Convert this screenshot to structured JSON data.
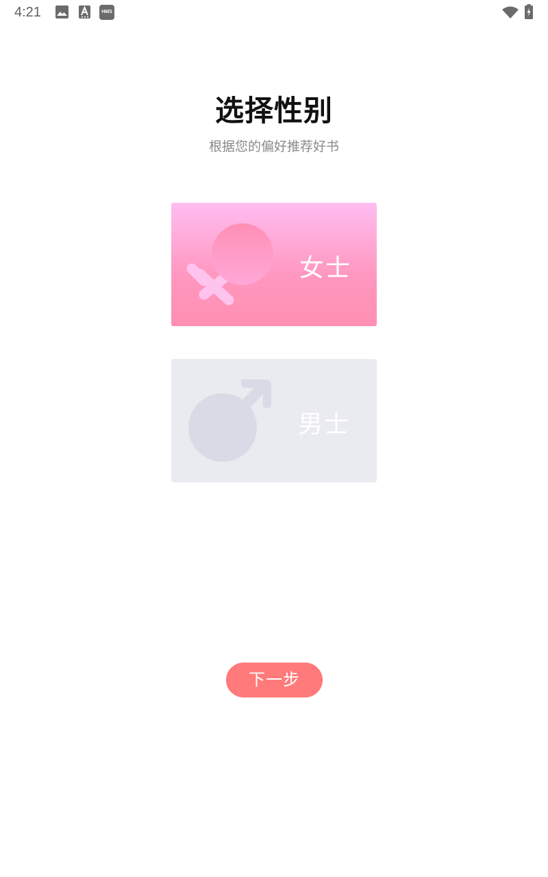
{
  "status_bar": {
    "time": "4:21",
    "hms_badge": "HMS",
    "icons": [
      "image-icon",
      "text-a-icon",
      "hms-icon",
      "wifi-icon",
      "battery-charging-icon"
    ]
  },
  "header": {
    "title": "选择性别",
    "subtitle": "根据您的偏好推荐好书"
  },
  "options": {
    "female": {
      "label": "女士",
      "icon": "female-symbol-icon",
      "selected": true
    },
    "male": {
      "label": "男士",
      "icon": "male-symbol-icon",
      "selected": false
    }
  },
  "next_button": {
    "label": "下一步"
  },
  "colors": {
    "female_gradient_top": "#ffbdf0",
    "female_gradient_bottom": "#ff8fb2",
    "male_card_bg": "#eaeaf1",
    "male_icon": "#d8dbe6",
    "next_button_bg": "#ff7a7a"
  }
}
